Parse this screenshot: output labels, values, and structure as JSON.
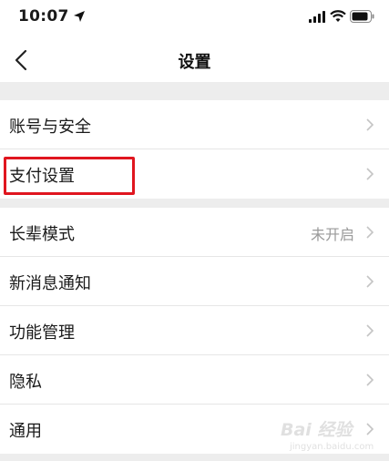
{
  "status_bar": {
    "time": "10:07"
  },
  "nav": {
    "title": "设置"
  },
  "groups": [
    {
      "items": [
        {
          "label": "账号与安全"
        },
        {
          "label": "支付设置"
        }
      ]
    },
    {
      "items": [
        {
          "label": "长辈模式",
          "value": "未开启"
        },
        {
          "label": "新消息通知"
        },
        {
          "label": "功能管理"
        },
        {
          "label": "隐私"
        },
        {
          "label": "通用"
        }
      ]
    }
  ],
  "watermark": {
    "text": "Bai 经验",
    "url": "jingyan.baidu.com"
  },
  "colors": {
    "highlight": "#e0161f",
    "background": "#ededed",
    "secondary_text": "#9a9a9a"
  }
}
